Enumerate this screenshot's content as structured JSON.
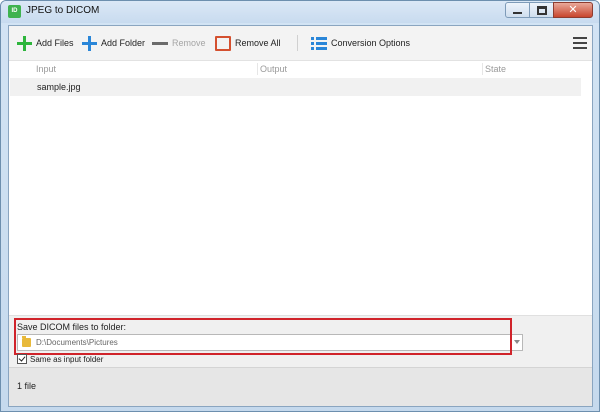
{
  "window": {
    "title": "JPEG to DICOM",
    "app_icon_text": "ID"
  },
  "toolbar": {
    "add_files": "Add Files",
    "add_folder": "Add Folder",
    "remove": "Remove",
    "remove_all": "Remove All",
    "conversion_options": "Conversion Options"
  },
  "file_list": {
    "columns": [
      "Input",
      "Output",
      "State"
    ],
    "rows": [
      {
        "input": "sample.jpg",
        "output": "",
        "state": ""
      }
    ]
  },
  "save": {
    "label": "Save DICOM files to folder:",
    "folder_path": "D:\\Documents\\Pictures",
    "same_as_input_label": "Same as input folder",
    "same_as_input_checked": true
  },
  "status": {
    "text": "1 file"
  },
  "colors": {
    "highlight_border": "#d0232a",
    "add_green": "#2db53c",
    "add_blue": "#2a86d8",
    "remove_all_red": "#d4502f"
  }
}
